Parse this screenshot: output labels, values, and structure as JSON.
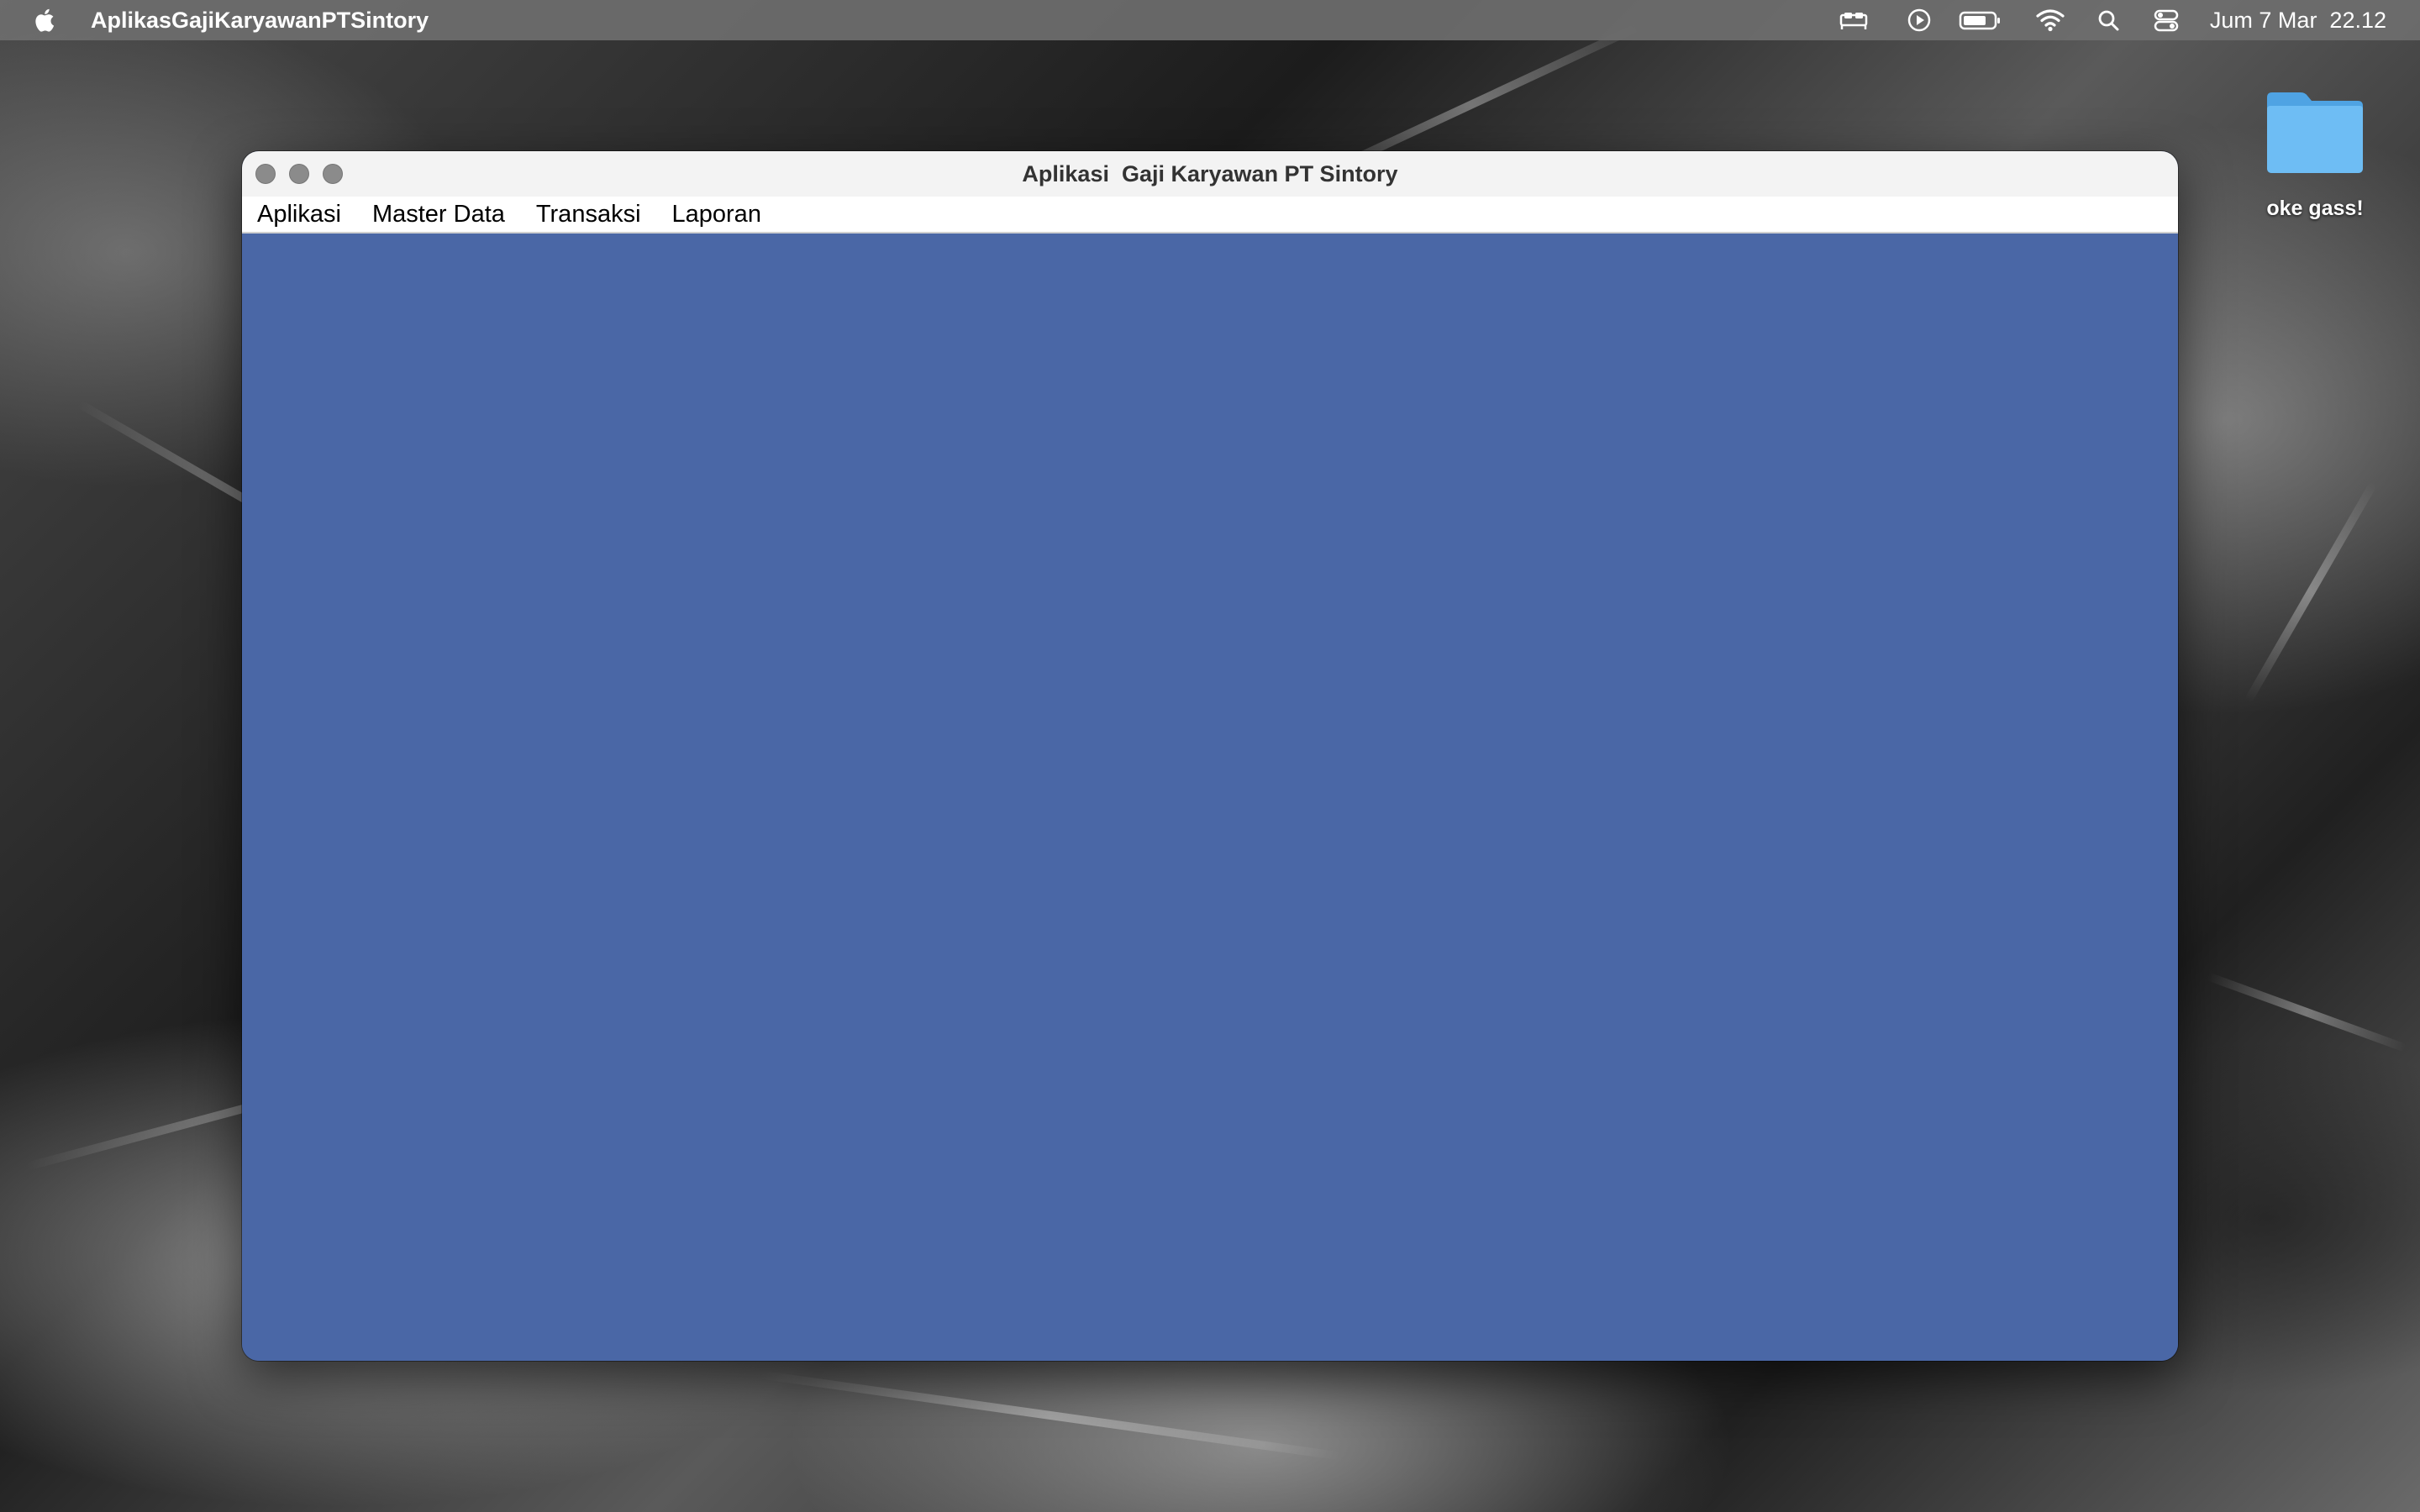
{
  "system_menubar": {
    "active_app": "AplikasGajiKaryawanPTSintory",
    "clock": "Jum 7 Mar  22.12",
    "icons": [
      "apple-icon",
      "sleep-icon",
      "play-icon",
      "battery-icon",
      "wifi-icon",
      "search-icon",
      "control-center-icon"
    ]
  },
  "desktop": {
    "folder_label": "oke gass!",
    "folder_color": "#5fb3ef"
  },
  "window": {
    "title": "Aplikasi  Gaji Karyawan PT Sintory",
    "menus": [
      "Aplikasi",
      "Master Data",
      "Transaksi",
      "Laporan"
    ],
    "content_color": "#4a67a6"
  }
}
